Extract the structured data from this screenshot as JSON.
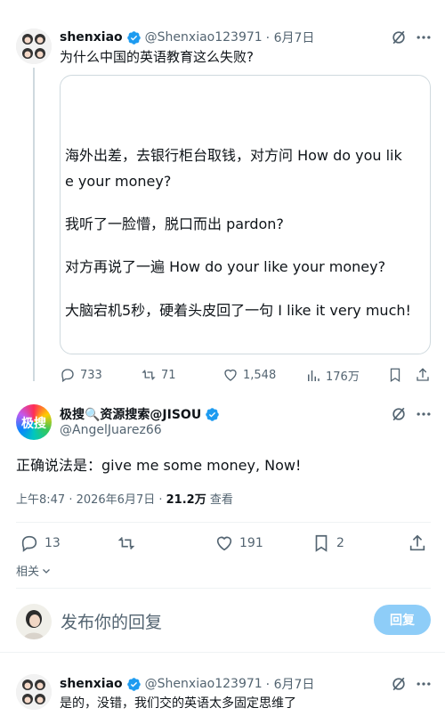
{
  "tweet1": {
    "name": "shenxiao",
    "handle": "@Shenxiao123971",
    "date": "· 6月7日",
    "text": "为什么中国的英语教育这么失败?",
    "quote_lines": [
      "海外出差，去银行柜台取钱，对方问 How do you lik",
      "e your money?",
      "我听了一脸懵，脱口而出 pardon?",
      "对方再说了一遍 How do your like your money?",
      "大脑宕机5秒，硬着头皮回了一句 I like it very much!"
    ],
    "stats": {
      "replies": "733",
      "retweets": "71",
      "likes": "1,548",
      "views": "176万"
    }
  },
  "tweet2": {
    "name": "极搜🔍资源搜索@JISOU",
    "handle": "@AngelJuarez66",
    "text": "正确说法是：give me some money, Now!",
    "meta_time": "上午8:47 · 2026年6月7日 · ",
    "meta_views": "21.2万",
    "meta_views_label": " 查看",
    "stats": {
      "replies": "13",
      "retweets": "",
      "likes": "191",
      "bookmarks": "2"
    },
    "related": "相关"
  },
  "reply_box": {
    "placeholder": "发布你的回复",
    "button": "回复"
  },
  "tweet3": {
    "name": "shenxiao",
    "handle": "@Shenxiao123971",
    "date": "· 6月7日",
    "text": "是的，没错，我们交的英语太多固定思维了"
  },
  "colors": {
    "verified": "#1d9bf0",
    "reply_button": "#8ecdf8",
    "text": "#0f1419",
    "muted": "#536471"
  }
}
